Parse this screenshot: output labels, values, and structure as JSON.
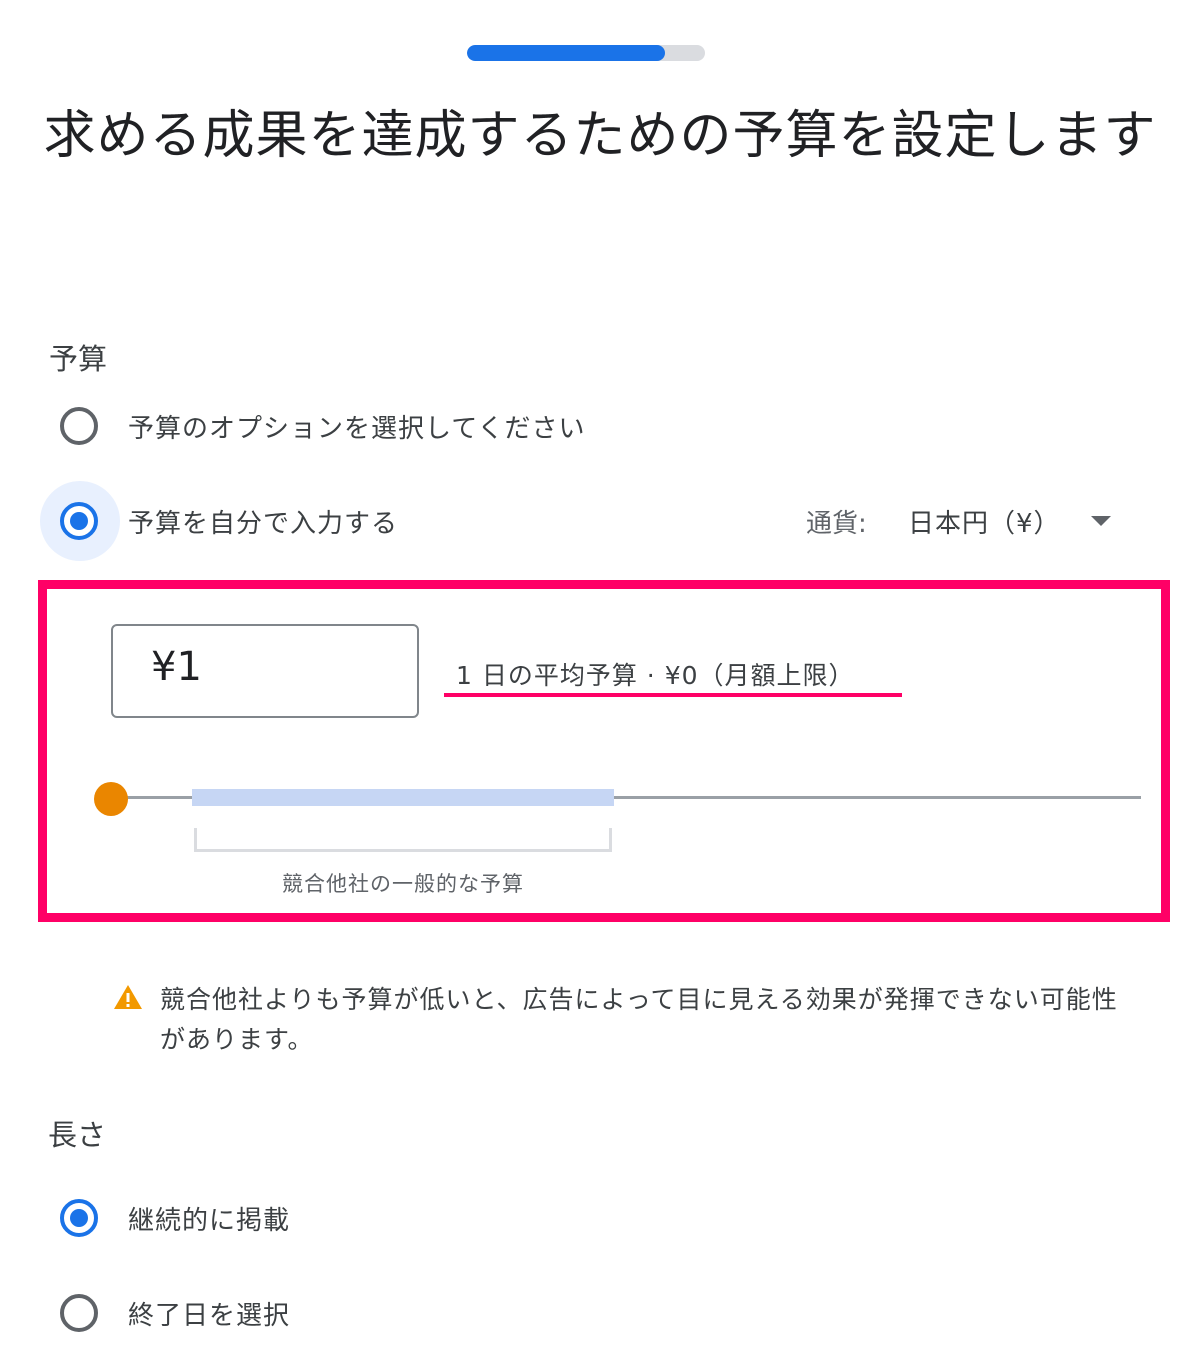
{
  "progress": {
    "fraction": 0.83
  },
  "title": "求める成果を達成するための予算を設定します",
  "budget_section": {
    "label": "予算",
    "options": [
      {
        "label": "予算のオプションを選択してください",
        "selected": false
      },
      {
        "label": "予算を自分で入力する",
        "selected": true
      }
    ],
    "currency_label": "通貨:",
    "currency_value": "日本円（¥）",
    "input_value": "¥1",
    "daily_text": "1 日の平均予算 · ¥0（月額上限）",
    "competitor_label": "競合他社の一般的な予算"
  },
  "warning": {
    "icon": "warning-icon",
    "text": "競合他社よりも予算が低いと、広告によって目に見える効果が発揮できない可能性があります。"
  },
  "length_section": {
    "label": "長さ",
    "options": [
      {
        "label": "継続的に掲載",
        "selected": true
      },
      {
        "label": "終了日を選択",
        "selected": false
      }
    ]
  },
  "colors": {
    "accent": "#1a73e8",
    "highlight": "#ff0066",
    "slider_thumb": "#ea8600",
    "warning": "#f29900"
  }
}
